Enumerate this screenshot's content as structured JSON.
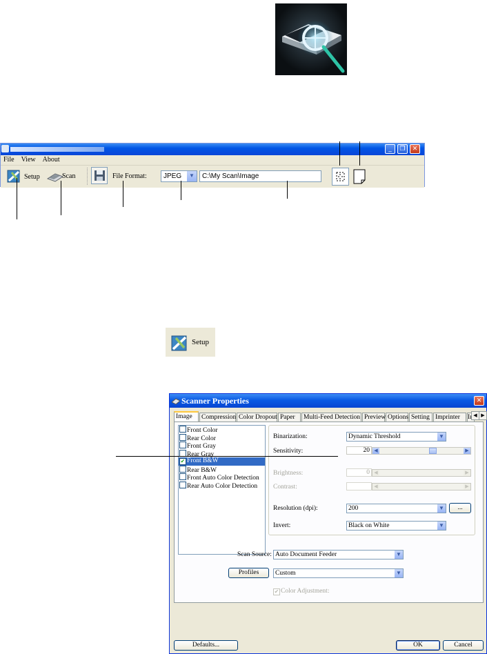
{
  "main_window": {
    "menu": [
      "File",
      "View",
      "About"
    ],
    "toolbar": {
      "setup_label": "Setup",
      "scan_label": "Scan",
      "file_format_label": "File Format:",
      "format_value": "JPEG",
      "path_value": "C:\\My Scan\\Image"
    }
  },
  "setup_sample": {
    "label": "Setup"
  },
  "dialog": {
    "title": "Scanner Properties",
    "tabs": [
      "Image",
      "Compression",
      "Color Dropout",
      "Paper",
      "Multi-Feed Detection",
      "Preview",
      "Options",
      "Setting",
      "Imprinter",
      "In"
    ],
    "image_types": [
      {
        "label": "Front Color",
        "checked": false
      },
      {
        "label": "Rear Color",
        "checked": false
      },
      {
        "label": "Front Gray",
        "checked": false
      },
      {
        "label": "Rear Gray",
        "checked": false
      },
      {
        "label": "Front B&W",
        "checked": true
      },
      {
        "label": "Rear B&W",
        "checked": false
      },
      {
        "label": "Front Auto Color Detection",
        "checked": false
      },
      {
        "label": "Rear Auto Color Detection",
        "checked": false
      }
    ],
    "binarization_label": "Binarization:",
    "binarization_value": "Dynamic Threshold",
    "sensitivity_label": "Sensitivity:",
    "sensitivity_value": "20",
    "brightness_label": "Brightness:",
    "brightness_value": "0",
    "contrast_label": "Contrast:",
    "resolution_label": "Resolution (dpi):",
    "resolution_value": "200",
    "more_button": "...",
    "invert_label": "Invert:",
    "invert_value": "Black on White",
    "scan_source_label": "Scan Source:",
    "scan_source_value": "Auto Document Feeder",
    "profiles_button": "Profiles",
    "profiles_value": "Custom",
    "color_adjustment_label": "Color Adjustment:",
    "defaults_button": "Defaults...",
    "ok_button": "OK",
    "cancel_button": "Cancel"
  }
}
